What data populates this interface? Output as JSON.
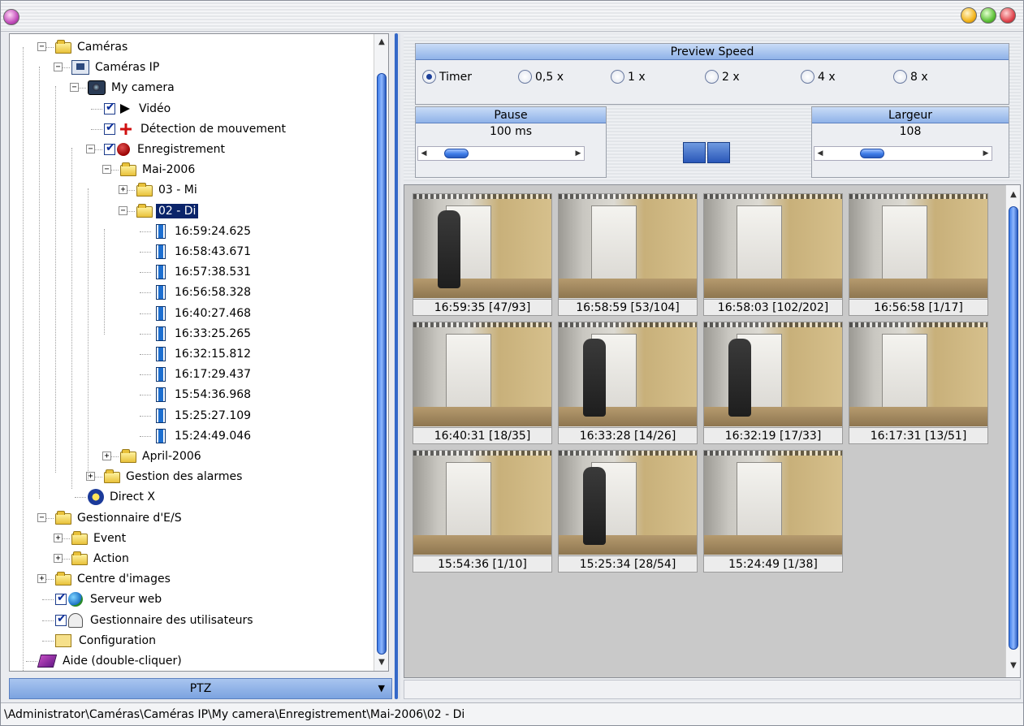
{
  "window": {
    "title": ""
  },
  "tree": {
    "nodes": [
      {
        "label": "Caméras",
        "icon": "folder-open-icon"
      },
      {
        "label": "Caméras IP",
        "icon": "ip-camera-icon"
      },
      {
        "label": "My camera",
        "icon": "camera-icon"
      },
      {
        "label": "Vidéo",
        "icon": "play-icon"
      },
      {
        "label": "Détection de mouvement",
        "icon": "motion-detection-icon"
      },
      {
        "label": "Enregistrement",
        "icon": "record-icon"
      },
      {
        "label": "Mai-2006",
        "icon": "folder-open-icon"
      },
      {
        "label": "03 - Mi",
        "icon": "folder-icon"
      },
      {
        "label": "02 - Di",
        "icon": "folder-open-icon"
      },
      {
        "label": "16:59:24.625",
        "icon": "film-icon"
      },
      {
        "label": "16:58:43.671",
        "icon": "film-icon"
      },
      {
        "label": "16:57:38.531",
        "icon": "film-icon"
      },
      {
        "label": "16:56:58.328",
        "icon": "film-icon"
      },
      {
        "label": "16:40:27.468",
        "icon": "film-icon"
      },
      {
        "label": "16:33:25.265",
        "icon": "film-icon"
      },
      {
        "label": "16:32:15.812",
        "icon": "film-icon"
      },
      {
        "label": "16:17:29.437",
        "icon": "film-icon"
      },
      {
        "label": "15:54:36.968",
        "icon": "film-icon"
      },
      {
        "label": "15:25:27.109",
        "icon": "film-icon"
      },
      {
        "label": "15:24:49.046",
        "icon": "film-icon"
      },
      {
        "label": "April-2006",
        "icon": "folder-icon"
      },
      {
        "label": "Gestion des alarmes",
        "icon": "folder-icon"
      },
      {
        "label": "Direct X",
        "icon": "directx-icon"
      },
      {
        "label": "Gestionnaire d'E/S",
        "icon": "folder-open-icon"
      },
      {
        "label": "Event",
        "icon": "folder-icon"
      },
      {
        "label": "Action",
        "icon": "folder-icon"
      },
      {
        "label": "Centre d'images",
        "icon": "folder-icon"
      },
      {
        "label": "Serveur web",
        "icon": "globe-icon"
      },
      {
        "label": "Gestionnaire des utilisateurs",
        "icon": "users-icon"
      },
      {
        "label": "Configuration",
        "icon": "config-icon"
      },
      {
        "label": "Aide (double-cliquer)",
        "icon": "help-book-icon"
      }
    ],
    "selected": "02 - Di"
  },
  "ptz": {
    "label": "PTZ"
  },
  "preview_speed": {
    "title": "Preview Speed",
    "options": [
      "Timer",
      "0,5 x",
      "1 x",
      "2 x",
      "4 x",
      "8 x"
    ],
    "selected": "Timer"
  },
  "pause": {
    "title": "Pause",
    "value": "100 ms"
  },
  "largeur": {
    "title": "Largeur",
    "value": "108"
  },
  "thumbnails": [
    {
      "caption": "16:59:35 [47/93]"
    },
    {
      "caption": "16:58:59 [53/104]"
    },
    {
      "caption": "16:58:03 [102/202]"
    },
    {
      "caption": "16:56:58 [1/17]"
    },
    {
      "caption": "16:40:31 [18/35]"
    },
    {
      "caption": "16:33:28 [14/26]"
    },
    {
      "caption": "16:32:19 [17/33]"
    },
    {
      "caption": "16:17:31 [13/51]"
    },
    {
      "caption": "15:54:36 [1/10]"
    },
    {
      "caption": "15:25:34 [28/54]"
    },
    {
      "caption": "15:24:49 [1/38]"
    }
  ],
  "status": {
    "path": "\\Administrator\\Caméras\\Caméras IP\\My camera\\Enregistrement\\Mai-2006\\02 - Di"
  }
}
